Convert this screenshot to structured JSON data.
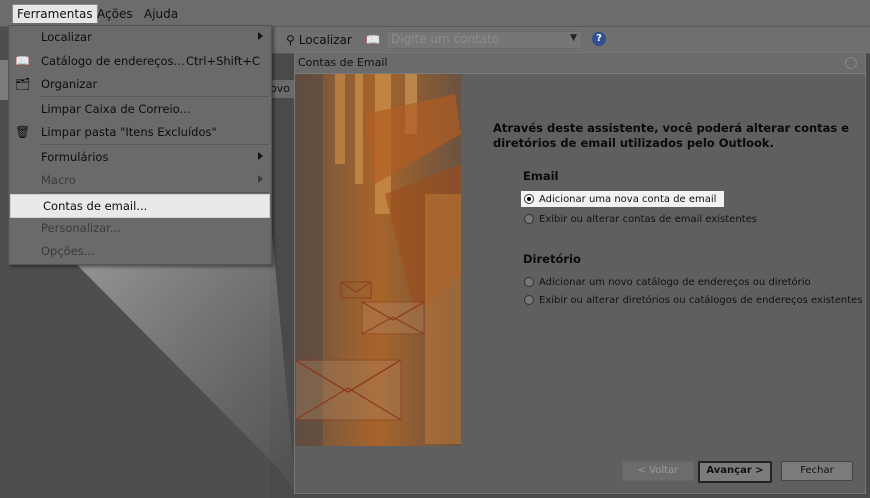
{
  "menubar": {
    "items": [
      "Ferramentas",
      "Ações",
      "Ajuda"
    ]
  },
  "toolbar": {
    "find_label": "Localizar",
    "contact_placeholder": "Digite um contato",
    "help_glyph": "?"
  },
  "left_pane": {
    "novo_fragment": "ovo"
  },
  "menu": {
    "items": [
      {
        "label": "Localizar",
        "shortcut": "",
        "submenu": true,
        "icon": "",
        "dim": false
      },
      {
        "label": "Catálogo de endereços...",
        "shortcut": "Ctrl+Shift+C",
        "submenu": false,
        "icon": "address-book-icon",
        "dim": false
      },
      {
        "label": "Organizar",
        "shortcut": "",
        "submenu": false,
        "icon": "organize-icon",
        "dim": false
      },
      {
        "label": "Limpar Caixa de Correio...",
        "shortcut": "",
        "submenu": false,
        "icon": "",
        "dim": false
      },
      {
        "label": "Limpar pasta \"Itens Excluídos\"",
        "shortcut": "",
        "submenu": false,
        "icon": "empty-trash-icon",
        "dim": false
      },
      {
        "label": "Formulários",
        "shortcut": "",
        "submenu": true,
        "icon": "",
        "dim": false
      },
      {
        "label": "Macro",
        "shortcut": "",
        "submenu": true,
        "icon": "",
        "dim": true
      },
      {
        "label": "Contas de email...",
        "shortcut": "",
        "submenu": false,
        "icon": "",
        "dim": false,
        "selected": true
      },
      {
        "label": "Personalizar...",
        "shortcut": "",
        "submenu": false,
        "icon": "",
        "dim": true
      },
      {
        "label": "Opções...",
        "shortcut": "",
        "submenu": false,
        "icon": "",
        "dim": true
      }
    ]
  },
  "dialog": {
    "title": "Contas de Email",
    "intro": "Através deste assistente, você poderá alterar contas e diretórios de email utilizados pelo Outlook.",
    "email_section": "Email",
    "email_options": [
      {
        "label": "Adicionar uma nova conta de email",
        "checked": true
      },
      {
        "label": "Exibir ou alterar contas de email existentes",
        "checked": false
      }
    ],
    "directory_section": "Diretório",
    "directory_options": [
      {
        "label": "Adicionar um novo catálogo de endereços ou diretório",
        "checked": false
      },
      {
        "label": "Exibir ou alterar diretórios ou catálogos de endereços existentes",
        "checked": false
      }
    ],
    "buttons": {
      "back": "< Voltar",
      "next": "Avançar >",
      "close": "Fechar"
    }
  },
  "colors": {
    "accent_orange": "#b5681f",
    "highlight": "#e9e9e9",
    "dim_background": "#4a4a4a"
  }
}
